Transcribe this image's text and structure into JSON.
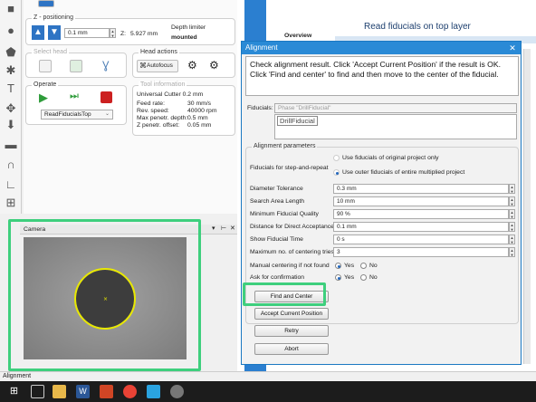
{
  "panel": {
    "z_group_title": "Z - positioning",
    "z_step_value": "0.1 mm",
    "z_readout_label": "Z:",
    "z_readout_value": "5.927 mm",
    "depth_limiter_label": "Depth limiter",
    "depth_limiter_status": "mounted",
    "select_head_title": "Select head",
    "head_actions_title": "Head actions",
    "autofocus_label": "Autofocus",
    "operate_title": "Operate",
    "operate_select_value": "ReadFiducialsTop",
    "tool_info_title": "Tool information",
    "tool_name": "Universal Cutter 0.2 mm",
    "tool_rows": [
      {
        "label": "Feed rate:",
        "value": "30 mm/s"
      },
      {
        "label": "Rev. speed:",
        "value": "40000 rpm"
      },
      {
        "label": "Max penetr. depth:",
        "value": "0.5 mm"
      },
      {
        "label": "Z penetr. offset:",
        "value": "0.05 mm"
      }
    ]
  },
  "bgdoc": {
    "overview_label": "Overview",
    "header_text": "Read fiducials on top layer"
  },
  "camera": {
    "title": "Camera",
    "header_icons": [
      "chevron-down-icon",
      "pin-icon",
      "close-icon"
    ]
  },
  "dialog": {
    "title": "Alignment",
    "message": "Check alignment result. Click 'Accept Current Position' if the result is OK. Click 'Find and center' to find and then move to the center of the fiducial.",
    "fiducials_label": "Fiducials:",
    "fiducials_value": "Phase \"DrillFiducial\"",
    "fiducial_list_item": "DrillFiducial",
    "params_title": "Alignment parameters",
    "step_repeat_label": "Fiducials for step-and-repeat",
    "step_repeat_options": [
      "Use fiducials of original project only",
      "Use outer fiducials of entire multiplied project"
    ],
    "params": [
      {
        "label": "Diameter Tolerance",
        "value": "0.3 mm"
      },
      {
        "label": "Search Area Length",
        "value": "10 mm"
      },
      {
        "label": "Minimum Fiducial Quality",
        "value": "90 %"
      },
      {
        "label": "Distance for Direct Acceptance",
        "value": "0.1 mm"
      },
      {
        "label": "Show Fiducial Time",
        "value": "0 s"
      },
      {
        "label": "Maximum no. of centering tries",
        "value": "3"
      }
    ],
    "manual_centering_label": "Manual centering if not found",
    "confirmation_label": "Ask for confirmation",
    "yes_label": "Yes",
    "no_label": "No",
    "buttons": {
      "find_center": "Find and Center",
      "accept": "Accept Current Position",
      "retry": "Retry",
      "abort": "Abort"
    }
  },
  "statusbar": {
    "text": "Alignment"
  },
  "colors": {
    "highlight": "#3ecf7d",
    "titlebar": "#2a8ad6",
    "dark": "#1c1c1c"
  }
}
